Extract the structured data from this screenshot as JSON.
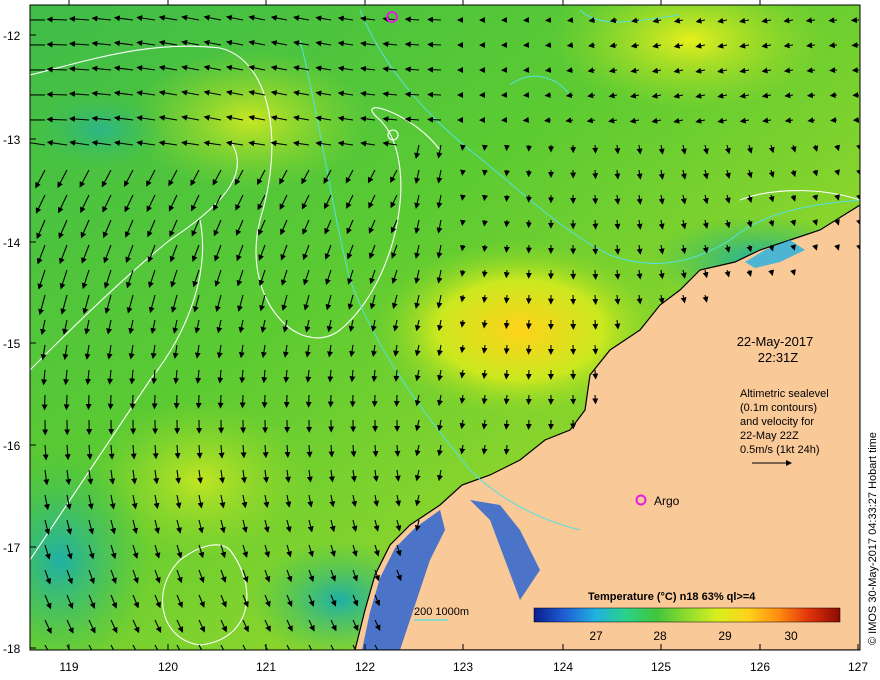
{
  "map": {
    "axes": {
      "lat_ticks": [
        "-12",
        "-13",
        "-14",
        "-15",
        "-16",
        "-17",
        "-18"
      ],
      "lon_ticks": [
        "119",
        "120",
        "121",
        "122",
        "123",
        "124",
        "125",
        "126",
        "127"
      ]
    },
    "datetime": {
      "date": "22-May-2017",
      "time": "22:31Z"
    },
    "altimetry_note": [
      "Altimetric sealevel",
      "(0.1m contours)",
      "and velocity for",
      "22-May 22Z",
      "0.5m/s (1kt 24h)"
    ],
    "argo_label": "Argo",
    "depth_label": "200  1000m",
    "colorbar": {
      "title": "Temperature (°C) n18 63% ql>=4",
      "ticks": [
        "27",
        "28",
        "29",
        "30"
      ],
      "colors": [
        "#0a1c8c",
        "#1f5fd4",
        "#21b0e0",
        "#2bd28a",
        "#41c53c",
        "#8fdc2e",
        "#d9ef1e",
        "#ffd21a",
        "#ff8c10",
        "#e0320a",
        "#8c0a05"
      ]
    },
    "credit": "© IMOS 30-May-2017 04:33:27 Hobart time",
    "colors": {
      "land": "#f9c998",
      "ocean_main": "#5cc83a",
      "coast": "#000000",
      "contour_sea": "#ffffff",
      "contour_depth": "#56e0e0",
      "argo": "#e020e0"
    }
  }
}
